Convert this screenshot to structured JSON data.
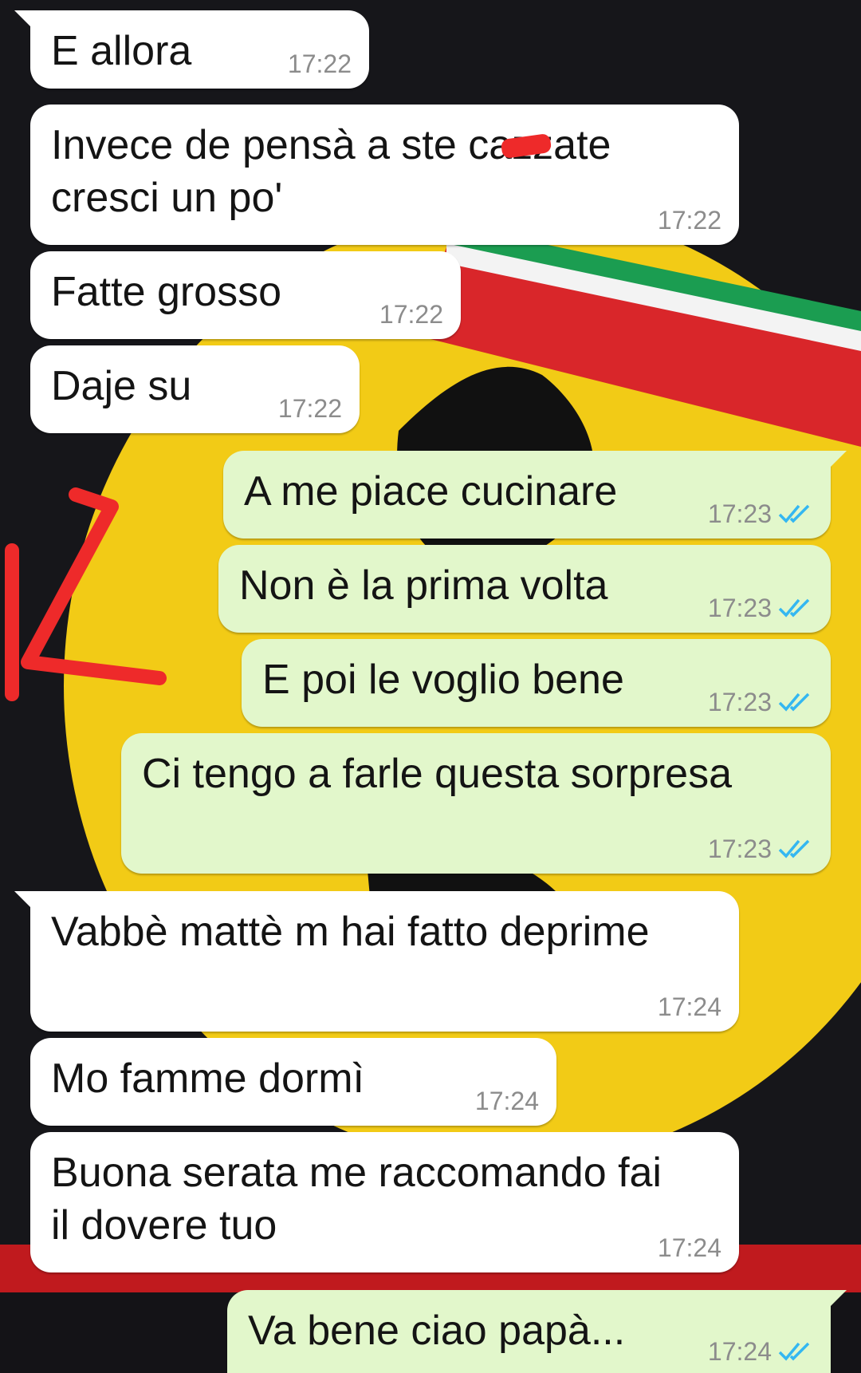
{
  "chat": {
    "messages": [
      {
        "direction": "incoming",
        "text": "E allora",
        "time": "17:22"
      },
      {
        "direction": "incoming",
        "text": "Invece de pensà a ste cazzate\ncresci un po'",
        "time": "17:22",
        "redacted": true
      },
      {
        "direction": "incoming",
        "text": "Fatte grosso",
        "time": "17:22"
      },
      {
        "direction": "incoming",
        "text": "Daje su",
        "time": "17:22"
      },
      {
        "direction": "outgoing",
        "text": "A me piace cucinare",
        "time": "17:23",
        "status": "read-double-check-icon"
      },
      {
        "direction": "outgoing",
        "text": "Non è la prima volta",
        "time": "17:23",
        "status": "read-double-check-icon"
      },
      {
        "direction": "outgoing",
        "text": "E poi le voglio bene",
        "time": "17:23",
        "status": "read-double-check-icon"
      },
      {
        "direction": "outgoing",
        "text": "Ci tengo a farle questa sorpresa",
        "time": "17:23",
        "status": "read-double-check-icon"
      },
      {
        "direction": "incoming",
        "text": "Vabbè mattè m hai fatto deprime",
        "time": "17:24"
      },
      {
        "direction": "incoming",
        "text": "Mo famme dormì",
        "time": "17:24"
      },
      {
        "direction": "incoming",
        "text": "Buona serata me raccomando fai\nil dovere tuo",
        "time": "17:24"
      },
      {
        "direction": "outgoing",
        "text": "Va bene ciao papà...",
        "time": "17:24",
        "status": "read-double-check-icon"
      }
    ]
  },
  "colors": {
    "incoming_bubble": "#ffffff",
    "outgoing_bubble": "#e2f7cb",
    "read_ticks": "#34b7f1",
    "timestamp": "#8c8c8c",
    "annotation_red": "#ee2a2a"
  }
}
